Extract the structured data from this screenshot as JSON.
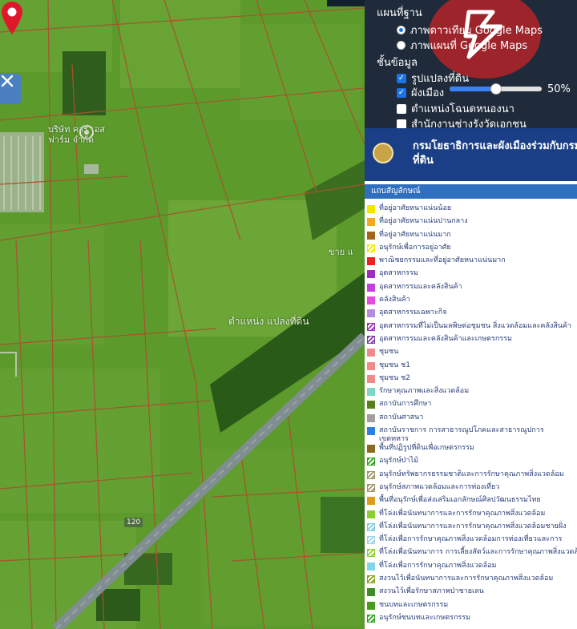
{
  "map": {
    "labels": {
      "farm": "บริษัท คาร์ เอส\nฟาร์ม จำกัด",
      "road_note": "ขาย แ",
      "pin_label": "ตำแหน่ง แปลงที่ดิน",
      "road_number": "120"
    },
    "colors": {
      "overlay": "#5d9a2c",
      "boundary": "#a5542c",
      "road": "#7c8a8f",
      "pin": "#e0162b"
    }
  },
  "panel": {
    "basemap": {
      "title": "แผนที่ฐาน",
      "options": [
        {
          "label": "ภาพดาวเทียม Google Maps",
          "selected": true
        },
        {
          "label": "ภาพแผนที่ Google Maps",
          "selected": false
        }
      ]
    },
    "layers": {
      "title": "ชั้นข้อมูล",
      "items": [
        {
          "label": "รูปแปลงที่ดิน",
          "checked": true
        },
        {
          "label": "ผังเมือง",
          "checked": true
        },
        {
          "label": "ตำแหน่งโฉนดหนองนา",
          "checked": false
        },
        {
          "label": "สำนักงานช่างรังวัดเอกชน",
          "checked": false
        }
      ],
      "opacity_label": "50%",
      "opacity_value": 0.5
    },
    "banner": "กรมโยธาธิการและผังเมืองร่วมกับกรม\nที่ดิน",
    "legend_title": "แถบสัญลักษณ์",
    "legend": [
      {
        "label": "ที่อยู่อาศัยหนาแน่นน้อย",
        "color": "#f5e600",
        "hatch": false
      },
      {
        "label": "ที่อยู่อาศัยหนาแน่นปานกลาง",
        "color": "#f5a623",
        "hatch": false
      },
      {
        "label": "ที่อยู่อาศัยหนาแน่นมาก",
        "color": "#a5641e",
        "hatch": false
      },
      {
        "label": "อนุรักษ์เพื่อการอยู่อาศัย",
        "color": "#f5e600",
        "hatch": true
      },
      {
        "label": "พาณิชยกรรมและที่อยู่อาศัยหนาแน่นมาก",
        "color": "#e52521",
        "hatch": false
      },
      {
        "label": "อุตสาหกรรม",
        "color": "#9b2fc0",
        "hatch": false
      },
      {
        "label": "อุตสาหกรรมและคลังสินค้า",
        "color": "#c23fe0",
        "hatch": false
      },
      {
        "label": "คลังสินค้า",
        "color": "#e24ae0",
        "hatch": false
      },
      {
        "label": "อุตสาหกรรมเฉพาะกิจ",
        "color": "#b48de0",
        "hatch": false
      },
      {
        "label": "อุตสาหกรรมที่ไม่เป็นมลพิษต่อชุมชน สิ่งแวดล้อมและคลังสินค้า",
        "color": "#9b2fc0",
        "hatch": true
      },
      {
        "label": "อุตสาหกรรมและคลังสินค้าและเกษตรกรรม",
        "color": "#7a3aa0",
        "hatch": true
      },
      {
        "label": "ชุมชน",
        "color": "#f08a8a",
        "hatch": false
      },
      {
        "label": "ชุมชน ช1",
        "color": "#f08a8a",
        "hatch": false
      },
      {
        "label": "ชุมชน ช2",
        "color": "#f08a8a",
        "hatch": false
      },
      {
        "label": "รักษาคุณภาพและสิ่งแวดล้อม",
        "color": "#7fd6c8",
        "hatch": false
      },
      {
        "label": "สถาบันการศึกษา",
        "color": "#5a7d1e",
        "hatch": false
      },
      {
        "label": "สถาบันศาสนา",
        "color": "#a0a0a0",
        "hatch": false
      },
      {
        "label": "สถาบันราชการ การสาธารณูปโภคและสาธารณูปการ\nเขตทหาร",
        "color": "#2f7ee0",
        "hatch": false
      },
      {
        "label": "พื้นที่ปฏิรูปที่ดินเพื่อเกษตรกรรม",
        "color": "#8a6a1e",
        "hatch": false
      },
      {
        "label": "อนุรักษ์ป่าไม้",
        "color": "#2fa01e",
        "hatch": true
      },
      {
        "label": "อนุรักษ์ทรัพยากรธรรมชาติและการรักษาคุณภาพสิ่งแวดล้อม",
        "color": "#a0946a",
        "hatch": true
      },
      {
        "label": "อนุรักษ์สภาพแวดล้อมและการท่องเที่ยว",
        "color": "#a0946a",
        "hatch": true
      },
      {
        "label": "พื้นที่อนุรักษ์เพื่อส่งเสริมเอกลักษณ์ศิลปวัฒนธรรมไทย",
        "color": "#e09a1e",
        "hatch": false
      },
      {
        "label": "ที่โล่งเพื่อนันทนาการและการรักษาคุณภาพสิ่งแวดล้อม",
        "color": "#8ad02f",
        "hatch": false
      },
      {
        "label": "ที่โล่งเพื่อนันทนาการและการรักษาคุณภาพสิ่งแวดล้อมชายฝั่ง",
        "color": "#7fc8e0",
        "hatch": true
      },
      {
        "label": "ที่โล่งเพื่อการรักษาคุณภาพสิ่งแวดล้อมการท่องเที่ยวและการ",
        "color": "#a0d0e8",
        "hatch": true
      },
      {
        "label": "ที่โล่งเพื่อนันทนาการ การเลี้ยงสัตว์และการรักษาคุณภาพสิ่งแวดล้อม",
        "color": "#8ad02f",
        "hatch": true
      },
      {
        "label": "ที่โล่งเพื่อการรักษาคุณภาพสิ่งแวดล้อม",
        "color": "#7fd6e8",
        "hatch": false
      },
      {
        "label": "สงวนไว้เพื่อนันทนาการและการรักษาคุณภาพสิ่งแวดล้อม",
        "color": "#8aa01e",
        "hatch": true
      },
      {
        "label": "สงวนไว้เพื่อรักษาสภาพป่าชายเลน",
        "color": "#3f8a2a",
        "hatch": false
      },
      {
        "label": "ชนบทและเกษตรกรรม",
        "color": "#4a9a1e",
        "hatch": false
      },
      {
        "label": "อนุรักษ์ชนบทและเกษตรกรรม",
        "color": "#2fa01e",
        "hatch": true
      }
    ]
  }
}
